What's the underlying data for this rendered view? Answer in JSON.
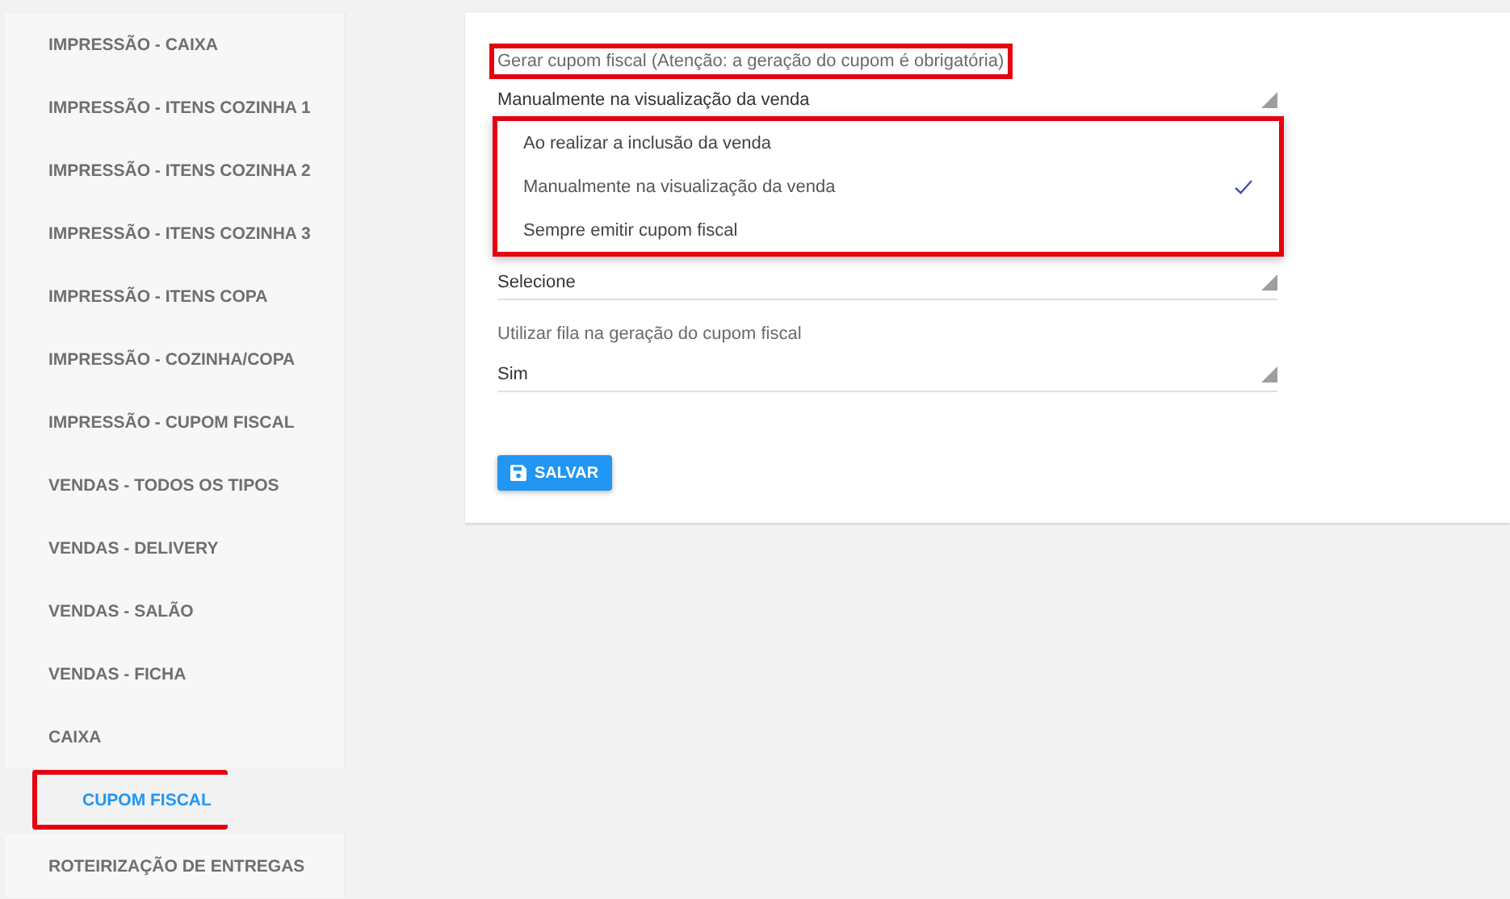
{
  "sidebar": {
    "items": [
      {
        "label": "IMPRESSÃO - CAIXA",
        "selected": false,
        "highlighted": false
      },
      {
        "label": "IMPRESSÃO - ITENS COZINHA 1",
        "selected": false,
        "highlighted": false
      },
      {
        "label": "IMPRESSÃO - ITENS COZINHA 2",
        "selected": false,
        "highlighted": false
      },
      {
        "label": "IMPRESSÃO - ITENS COZINHA 3",
        "selected": false,
        "highlighted": false
      },
      {
        "label": "IMPRESSÃO - ITENS COPA",
        "selected": false,
        "highlighted": false
      },
      {
        "label": "IMPRESSÃO - COZINHA/COPA",
        "selected": false,
        "highlighted": false
      },
      {
        "label": "IMPRESSÃO - CUPOM FISCAL",
        "selected": false,
        "highlighted": false
      },
      {
        "label": "VENDAS - TODOS OS TIPOS",
        "selected": false,
        "highlighted": false
      },
      {
        "label": "VENDAS - DELIVERY",
        "selected": false,
        "highlighted": false
      },
      {
        "label": "VENDAS - SALÃO",
        "selected": false,
        "highlighted": false
      },
      {
        "label": "VENDAS - FICHA",
        "selected": false,
        "highlighted": false
      },
      {
        "label": "CAIXA",
        "selected": false,
        "highlighted": false
      },
      {
        "label": "CUPOM FISCAL",
        "selected": true,
        "highlighted": true
      },
      {
        "label": "ROTEIRIZAÇÃO DE ENTREGAS",
        "selected": false,
        "highlighted": false
      }
    ]
  },
  "form": {
    "fields": [
      {
        "label": "Gerar cupom fiscal (Atenção: a geração do cupom é obrigatória)",
        "label_highlighted": true,
        "value": "Manualmente na visualização da venda",
        "focused": true
      },
      {
        "value": "Selecione",
        "focused": false
      },
      {
        "label": "Utilizar fila na geração do cupom fiscal",
        "label_highlighted": false,
        "value": "Sim",
        "focused": false
      }
    ],
    "dropdown": {
      "highlighted": true,
      "options": [
        {
          "label": "Ao realizar a inclusão da venda",
          "selected": false
        },
        {
          "label": "Manualmente na visualização da venda",
          "selected": true
        },
        {
          "label": "Sempre emitir cupom fiscal",
          "selected": false
        }
      ]
    },
    "save_button": "SALVAR"
  }
}
